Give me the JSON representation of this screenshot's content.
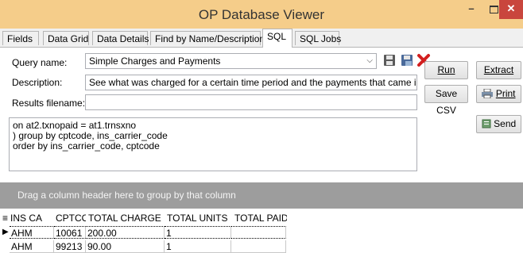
{
  "window": {
    "title": "OP Database Viewer"
  },
  "tabs": [
    {
      "label": "Fields",
      "active": false
    },
    {
      "label": "Data Grid",
      "active": false
    },
    {
      "label": "Data Details",
      "active": false
    },
    {
      "label": "Find by Name/Description",
      "active": false
    },
    {
      "label": "SQL",
      "active": true
    },
    {
      "label": "SQL Jobs",
      "active": false
    }
  ],
  "form": {
    "query_name_label": "Query name:",
    "query_name_value": "Simple Charges and Payments",
    "description_label": "Description:",
    "description_value": "See what was charged for a certain time period and the payments that came in (at",
    "results_label": "Results filename:",
    "results_value": ""
  },
  "buttons": {
    "run": "Run",
    "extract": "Extract",
    "save_csv": "Save CSV",
    "print": "Print",
    "send": "Send"
  },
  "sql_lines": [
    "on at2.txnopaid = at1.trnsxno",
    ") group by cptcode, ins_carrier_code",
    "order by ins_carrier_code, cptcode"
  ],
  "group_panel_text": "Drag a column header here to group by that column",
  "grid": {
    "columns": [
      "INS CA",
      "CPTCO",
      "TOTAL CHARGE",
      "TOTAL UNITS",
      "TOTAL PAID"
    ],
    "rows": [
      [
        "AHM",
        "10061",
        "200.00",
        "1",
        ""
      ],
      [
        "AHM",
        "99213",
        "90.00",
        "1",
        ""
      ]
    ]
  }
}
